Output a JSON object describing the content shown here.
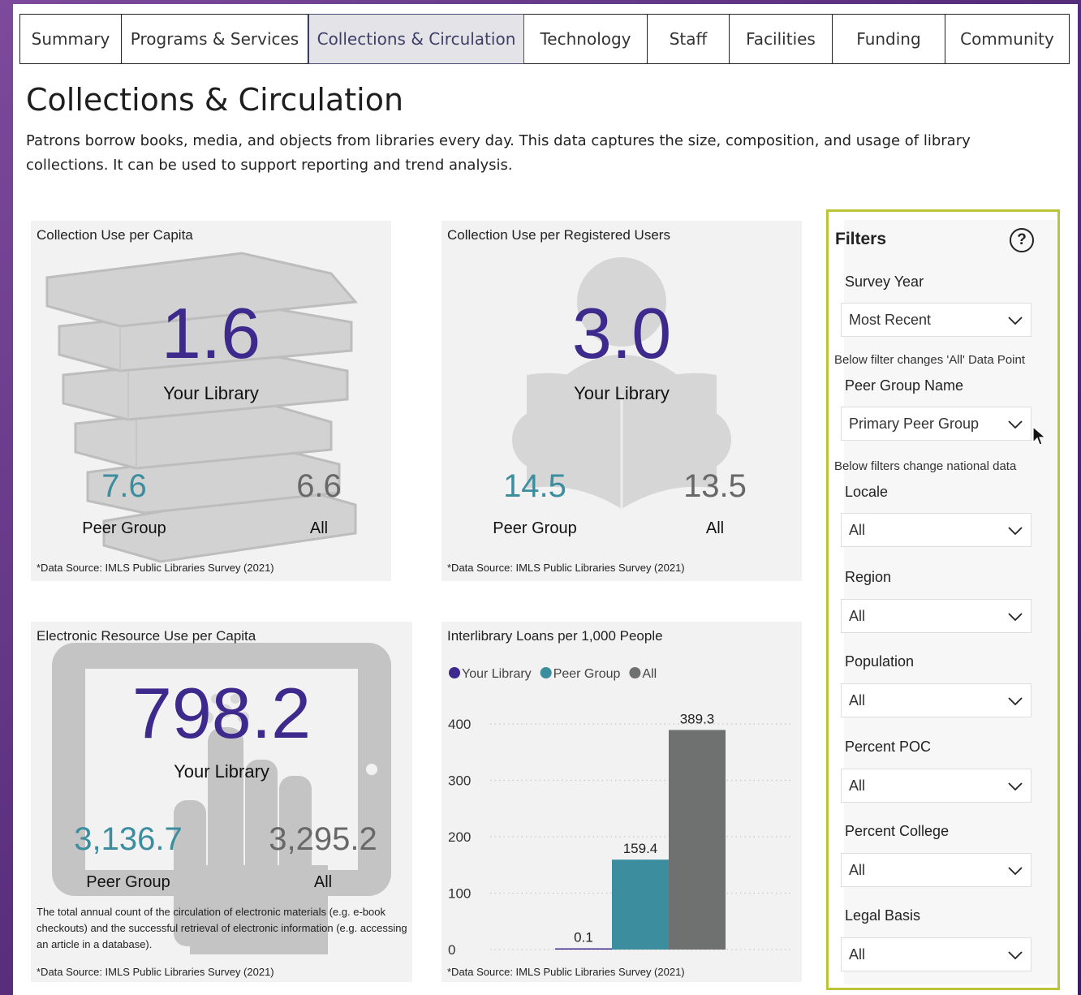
{
  "tabs": [
    {
      "label": "Summary",
      "active": false
    },
    {
      "label": "Programs & Services",
      "active": false
    },
    {
      "label": "Collections & Circulation",
      "active": true
    },
    {
      "label": "Technology",
      "active": false
    },
    {
      "label": "Staff",
      "active": false
    },
    {
      "label": "Facilities",
      "active": false
    },
    {
      "label": "Funding",
      "active": false
    },
    {
      "label": "Community",
      "active": false
    }
  ],
  "page": {
    "title": "Collections & Circulation",
    "description": "Patrons borrow books, media, and objects from libraries every day. This data captures the size, composition, and usage of library collections. It can be used to support reporting and trend analysis."
  },
  "cards": {
    "use_per_capita": {
      "title": "Collection Use per Capita",
      "value": "1.6",
      "value_label": "Your Library",
      "peer_value": "7.6",
      "peer_label": "Peer Group",
      "all_value": "6.6",
      "all_label": "All",
      "source": "*Data Source: IMLS Public Libraries Survey (2021)",
      "icon": "books-icon"
    },
    "use_per_registered": {
      "title": "Collection Use per Registered Users",
      "value": "3.0",
      "value_label": "Your Library",
      "peer_value": "14.5",
      "peer_label": "Peer Group",
      "all_value": "13.5",
      "all_label": "All",
      "source": "*Data Source: IMLS Public Libraries Survey (2021)",
      "icon": "reader-icon"
    },
    "electronic_use": {
      "title": "Electronic Resource Use per Capita",
      "value": "798.2",
      "value_label": "Your Library",
      "peer_value": "3,136.7",
      "peer_label": "Peer Group",
      "all_value": "3,295.2",
      "all_label": "All",
      "note": "The total annual count of the circulation of electronic materials (e.g. e-book checkouts) and the successful retrieval of electronic information (e.g. accessing an article in a database).",
      "source": "*Data Source: IMLS Public Libraries Survey (2021)",
      "icon": "tablet-tap-icon"
    },
    "interlibrary": {
      "title": "Interlibrary Loans per 1,000 People",
      "source": "*Data Source: IMLS Public Libraries Survey (2021)"
    }
  },
  "chart_data": {
    "type": "bar",
    "title": "Interlibrary Loans per 1,000 People",
    "categories": [
      "Your Library",
      "Peer Group",
      "All"
    ],
    "values": [
      0.1,
      159.4,
      389.3
    ],
    "value_labels": [
      "0.1",
      "159.4",
      "389.3"
    ],
    "colors": [
      "#3d2a8c",
      "#3c8d9e",
      "#6e716f"
    ],
    "ylim": [
      0,
      400
    ],
    "yticks": [
      0,
      100,
      200,
      300,
      400
    ],
    "legend": "top-left",
    "grid": "dotted horizontal"
  },
  "filters": {
    "title": "Filters",
    "help": "?",
    "note_peer": "Below filter changes 'All' Data Point",
    "note_national": "Below filters change national data",
    "items": [
      {
        "label": "Survey Year",
        "value": "Most Recent"
      },
      {
        "label": "Peer Group Name",
        "value": "Primary Peer Group"
      },
      {
        "label": "Locale",
        "value": "All"
      },
      {
        "label": "Region",
        "value": "All"
      },
      {
        "label": "Population",
        "value": "All"
      },
      {
        "label": "Percent POC",
        "value": "All"
      },
      {
        "label": "Percent College",
        "value": "All"
      },
      {
        "label": "Legal Basis",
        "value": "All"
      }
    ]
  },
  "colors": {
    "your_library": "#3d2a8c",
    "peer_group": "#3c8d9e",
    "all": "#686868",
    "filter_border": "#bcc43a",
    "background": "#5a2f7e"
  }
}
